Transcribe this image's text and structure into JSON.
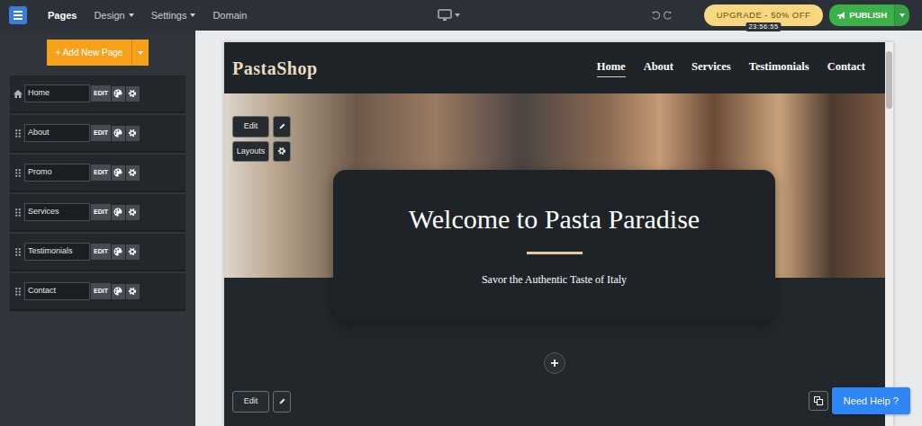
{
  "topbar": {
    "nav": [
      {
        "label": "Pages",
        "selected": true,
        "dropdown": false
      },
      {
        "label": "Design",
        "selected": false,
        "dropdown": true
      },
      {
        "label": "Settings",
        "selected": false,
        "dropdown": true
      },
      {
        "label": "Domain",
        "selected": false,
        "dropdown": false
      }
    ],
    "upgrade": {
      "label": "UPGRADE - 50% OFF",
      "timer": "23:56:55"
    },
    "publish": {
      "label": "PUBLISH"
    }
  },
  "sidebar": {
    "add_button": "+ Add New Page",
    "pages": [
      {
        "name": "Home",
        "kind": "home",
        "edit": "EDIT"
      },
      {
        "name": "About",
        "kind": "page",
        "edit": "EDIT"
      },
      {
        "name": "Promo",
        "kind": "page",
        "edit": "EDIT"
      },
      {
        "name": "Services",
        "kind": "page",
        "edit": "EDIT"
      },
      {
        "name": "Testimonials",
        "kind": "page",
        "edit": "EDIT"
      },
      {
        "name": "Contact",
        "kind": "page",
        "edit": "EDIT"
      }
    ]
  },
  "site": {
    "brand": "PastaShop",
    "nav": [
      {
        "label": "Home",
        "selected": true
      },
      {
        "label": "About",
        "selected": false
      },
      {
        "label": "Services",
        "selected": false
      },
      {
        "label": "Testimonials",
        "selected": false
      },
      {
        "label": "Contact",
        "selected": false
      }
    ],
    "hero": {
      "title": "Welcome to Pasta Paradise",
      "subtitle": "Savor the Authentic Taste of Italy"
    },
    "tools": {
      "edit": "Edit",
      "layouts": "Layouts"
    },
    "section_tools": {
      "edit": "Edit"
    }
  },
  "help": {
    "label": "Need Help ?"
  }
}
